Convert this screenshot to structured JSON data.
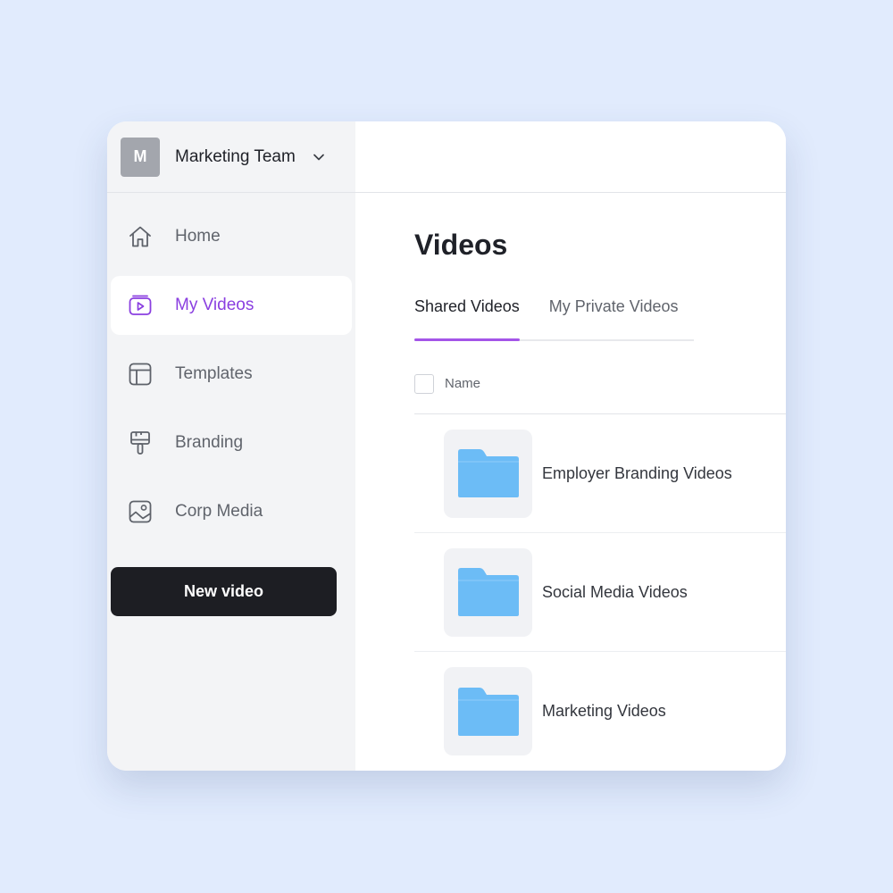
{
  "sidebar": {
    "team": {
      "avatar_letter": "M",
      "name": "Marketing Team"
    },
    "items": [
      {
        "label": "Home",
        "icon": "home-icon",
        "active": false
      },
      {
        "label": "My Videos",
        "icon": "video-play-icon",
        "active": true
      },
      {
        "label": "Templates",
        "icon": "layout-icon",
        "active": false
      },
      {
        "label": "Branding",
        "icon": "paint-brush-icon",
        "active": false
      },
      {
        "label": "Corp Media",
        "icon": "image-icon",
        "active": false
      }
    ],
    "new_video_label": "New video"
  },
  "main": {
    "title": "Videos",
    "tabs": [
      {
        "label": "Shared Videos",
        "active": true
      },
      {
        "label": "My Private Videos",
        "active": false
      }
    ],
    "list": {
      "column_name": "Name",
      "rows": [
        {
          "name": "Employer Branding Videos",
          "icon": "folder-icon"
        },
        {
          "name": "Social Media Videos",
          "icon": "folder-icon"
        },
        {
          "name": "Marketing Videos",
          "icon": "folder-icon"
        }
      ]
    }
  },
  "colors": {
    "background": "#e1ebfd",
    "accent": "#8a3fe0",
    "button_dark": "#1d1e23",
    "folder": "#6cbcf6"
  }
}
